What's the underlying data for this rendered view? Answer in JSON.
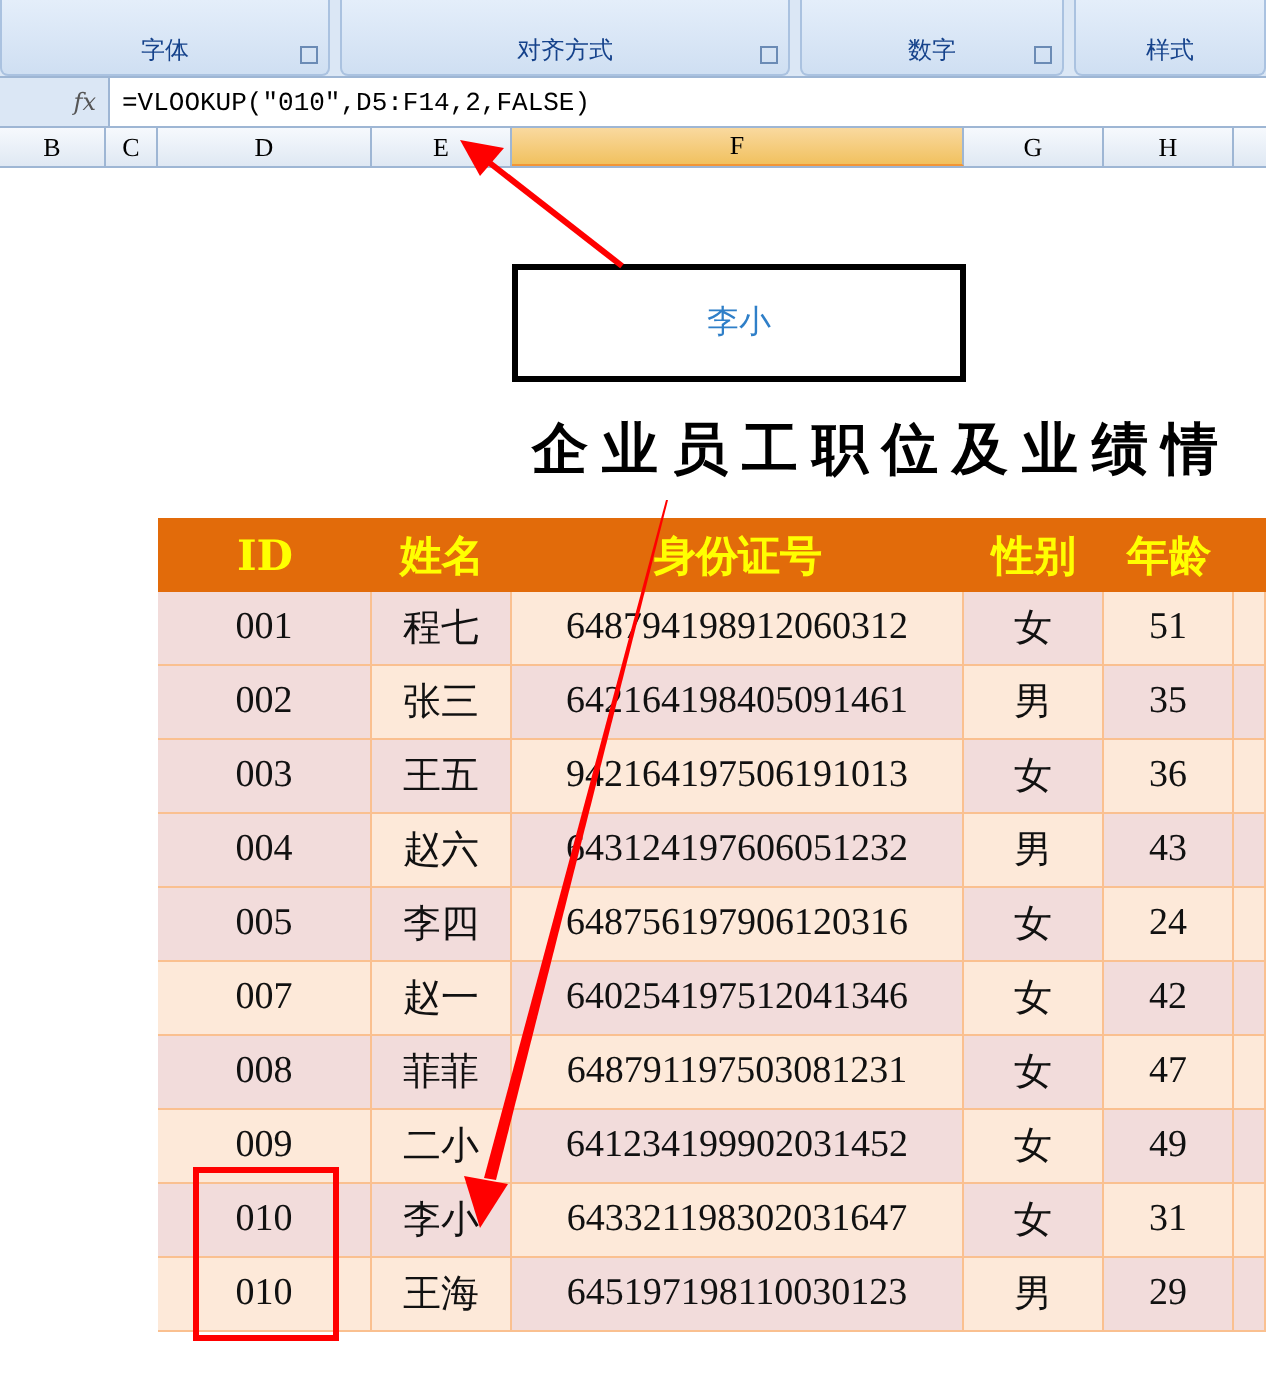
{
  "ribbon": {
    "groups": [
      "字体",
      "对齐方式",
      "数字",
      "样式"
    ]
  },
  "formula_bar": {
    "fx": "fx",
    "formula": "=VLOOKUP(″010″,D5:F14,2,FALSE)"
  },
  "column_headers": [
    {
      "label": "B",
      "selected": false
    },
    {
      "label": "C",
      "selected": false
    },
    {
      "label": "D",
      "selected": false
    },
    {
      "label": "E",
      "selected": false
    },
    {
      "label": "F",
      "selected": true
    },
    {
      "label": "G",
      "selected": false
    },
    {
      "label": "H",
      "selected": false
    }
  ],
  "result_cell": {
    "value": "李小"
  },
  "title": "企业员工职位及业绩情",
  "table": {
    "columns": [
      "ID",
      "姓名",
      "身份证号",
      "性别",
      "年龄"
    ],
    "rows": [
      [
        "001",
        "程七",
        "648794198912060312",
        "女",
        "51"
      ],
      [
        "002",
        "张三",
        "642164198405091461",
        "男",
        "35"
      ],
      [
        "003",
        "王五",
        "942164197506191013",
        "女",
        "36"
      ],
      [
        "004",
        "赵六",
        "643124197606051232",
        "男",
        "43"
      ],
      [
        "005",
        "李四",
        "648756197906120316",
        "女",
        "24"
      ],
      [
        "007",
        "赵一",
        "640254197512041346",
        "女",
        "42"
      ],
      [
        "008",
        "菲菲",
        "648791197503081231",
        "女",
        "47"
      ],
      [
        "009",
        "二小",
        "641234199902031452",
        "女",
        "49"
      ],
      [
        "010",
        "李小",
        "643321198302031647",
        "女",
        "31"
      ],
      [
        "010",
        "王海",
        "645197198110030123",
        "男",
        "29"
      ]
    ]
  }
}
